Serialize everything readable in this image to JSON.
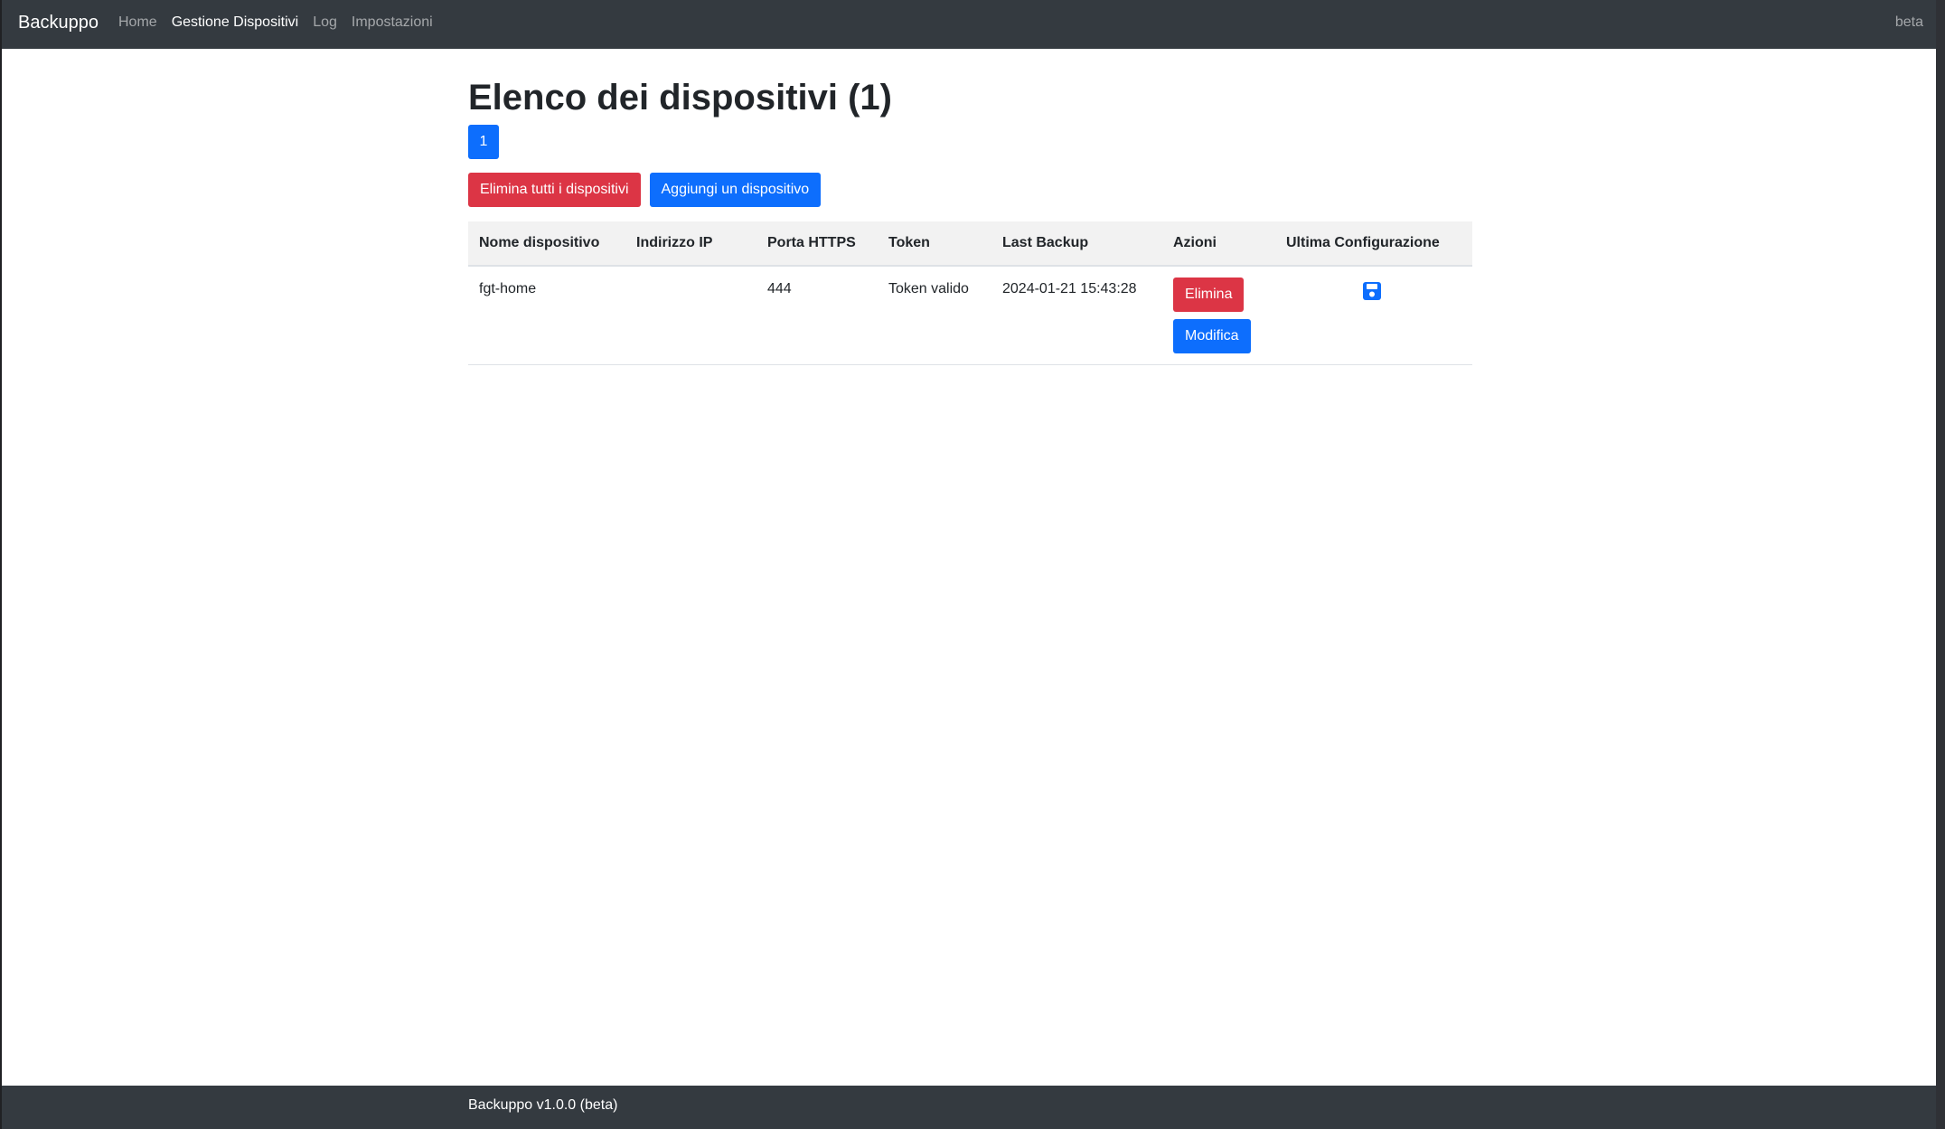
{
  "navbar": {
    "brand": "Backuppo",
    "links": [
      {
        "label": "Home",
        "active": false
      },
      {
        "label": "Gestione Dispositivi",
        "active": true
      },
      {
        "label": "Log",
        "active": false
      },
      {
        "label": "Impostazioni",
        "active": false
      }
    ],
    "right_label": "beta"
  },
  "page": {
    "title": "Elenco dei dispositivi (1)",
    "pagination": [
      "1"
    ],
    "delete_all_label": "Elimina tutti i dispositivi",
    "add_device_label": "Aggiungi un dispositivo"
  },
  "table": {
    "headers": [
      "Nome dispositivo",
      "Indirizzo IP",
      "Porta HTTPS",
      "Token",
      "Last Backup",
      "Azioni",
      "Ultima Configurazione"
    ],
    "rows": [
      {
        "name": "fgt-home",
        "ip": "",
        "port": "444",
        "token": "Token valido",
        "last_backup": "2024-01-21 15:43:28",
        "delete_label": "Elimina",
        "edit_label": "Modifica",
        "config_icon": "floppy-disk-icon"
      }
    ]
  },
  "footer": {
    "text": "Backuppo v1.0.0 (beta)"
  },
  "colors": {
    "navbar_bg": "#343a40",
    "primary": "#0d6efd",
    "danger": "#dc3545",
    "table_header_bg": "#f2f2f2"
  }
}
